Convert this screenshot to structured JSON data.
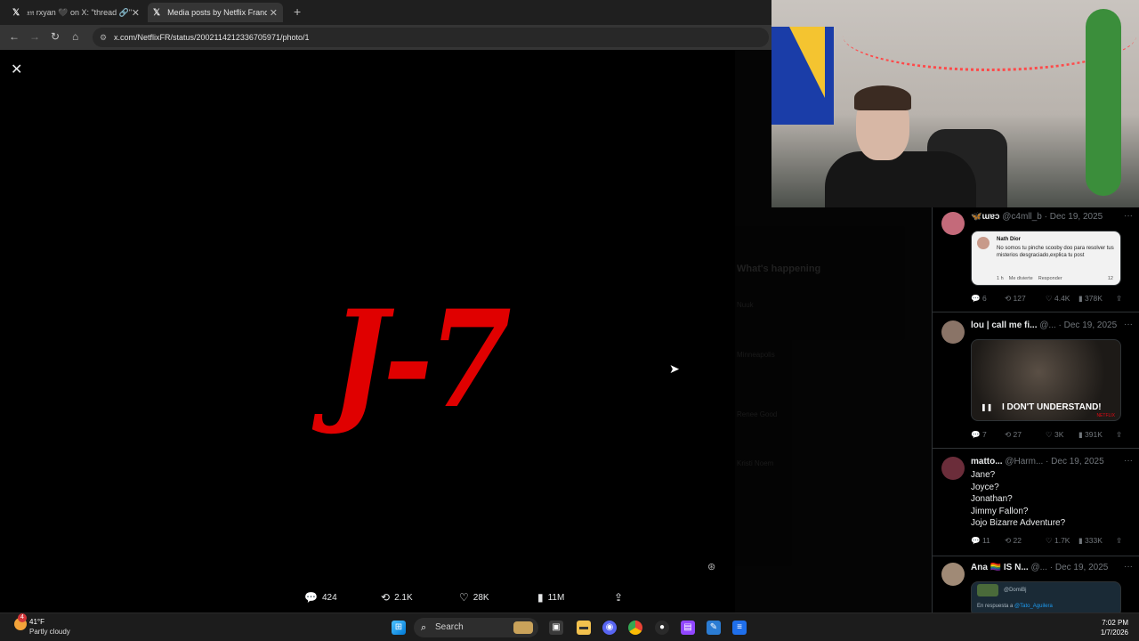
{
  "browser": {
    "tabs": [
      {
        "label": "𝔵𝔫 rxyan 🖤 on X: \"thread 🔗\"",
        "active": false
      },
      {
        "label": "Media posts by Netflix France (",
        "active": true
      }
    ],
    "url": "x.com/NetflixFR/status/2002114212336705971/photo/1"
  },
  "viewer": {
    "image_text": "J-7",
    "actions": {
      "replies": "424",
      "reposts": "2.1K",
      "likes": "28K",
      "views": "11M"
    },
    "side_ghost": {
      "whats_happening": "What's happening",
      "trend1": "Nuuk",
      "trend2": "Minneapolis",
      "trend3": "Renee Good",
      "trend4": "Kristi Noem"
    }
  },
  "feed": {
    "tweets": [
      {
        "name": "🦋ɯɐɔ",
        "handle": "@c4mll_b · Dec 19, 2025",
        "embed": {
          "author": "Nath Dior",
          "text": "No somos tu pinche scooby doo para resolver tus misterios desgraciado,explica tu post",
          "meta": "1 h    Me divierte    Responder",
          "count": "12"
        },
        "stats": {
          "replies": "6",
          "reposts": "127",
          "likes": "4.4K",
          "views": "378K"
        }
      },
      {
        "name": "lou | call me fi...",
        "handle": "@... · Dec 19, 2025",
        "video_caption": "I DON'T UNDERSTAND!",
        "video_brand": "NETFLIX",
        "stats": {
          "replies": "7",
          "reposts": "27",
          "likes": "3K",
          "views": "391K"
        }
      },
      {
        "name": "matto...",
        "handle": "@Harm... · Dec 19, 2025",
        "lines": [
          "Jane?",
          "Joyce?",
          "Jonathan?",
          "Jimmy Fallon?",
          "Jojo Bizarre Adventure?"
        ],
        "stats": {
          "replies": "11",
          "reposts": "22",
          "likes": "1.7K",
          "views": "333K"
        }
      },
      {
        "name": "Ana 🏳️‍🌈 IS N...",
        "handle": "@... · Dec 19, 2025",
        "embed_handle": "@DomiBj",
        "reply_to_prefix": "En respuesta a ",
        "reply_to": "@Tato_Aguilera"
      }
    ]
  },
  "taskbar": {
    "weather_badge": "4",
    "temperature": "41°F",
    "condition": "Partly cloudy",
    "search_placeholder": "Search",
    "time": "7:02 PM",
    "date": "1/7/2026"
  },
  "colors": {
    "j7_red": "#e00000",
    "x_text": "#e7e9ea",
    "x_muted": "#71767b",
    "x_border": "#2f3336"
  }
}
